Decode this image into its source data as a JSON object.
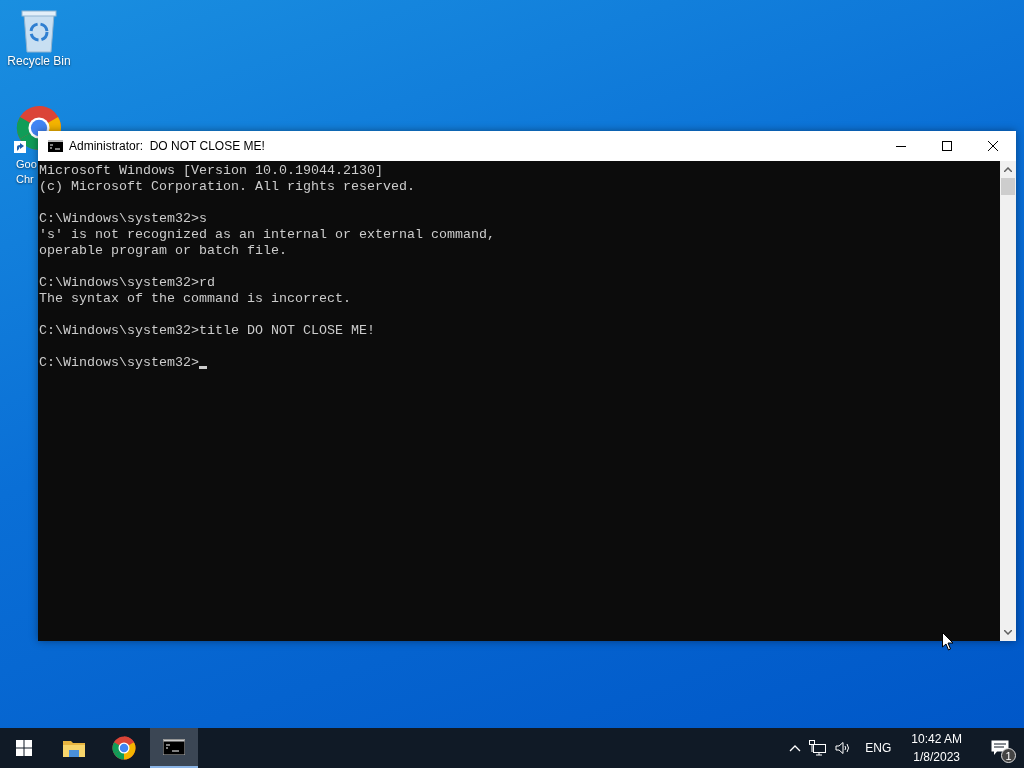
{
  "desktop_icons": [
    {
      "kind": "recycle-bin",
      "label_lines": [
        "Recycle Bin"
      ]
    },
    {
      "kind": "chrome",
      "label_lines": [
        "Goo",
        "Chr"
      ]
    }
  ],
  "window": {
    "title": "Administrator:  DO NOT CLOSE ME!",
    "console_blocks": [
      [
        "Microsoft Windows [Version 10.0.19044.2130]",
        "(c) Microsoft Corporation. All rights reserved."
      ],
      [
        "C:\\Windows\\system32>s",
        "'s' is not recognized as an internal or external command,",
        "operable program or batch file."
      ],
      [
        "C:\\Windows\\system32>rd",
        "The syntax of the command is incorrect."
      ],
      [
        "C:\\Windows\\system32>title DO NOT CLOSE ME!"
      ],
      [
        "C:\\Windows\\system32>"
      ]
    ]
  },
  "taskbar": {
    "apps": [
      {
        "kind": "explorer",
        "selected": false
      },
      {
        "kind": "chrome",
        "selected": false
      },
      {
        "kind": "terminal",
        "selected": true
      }
    ],
    "language": "ENG",
    "time": "10:42 AM",
    "date": "1/8/2023",
    "notification_count": "1"
  }
}
